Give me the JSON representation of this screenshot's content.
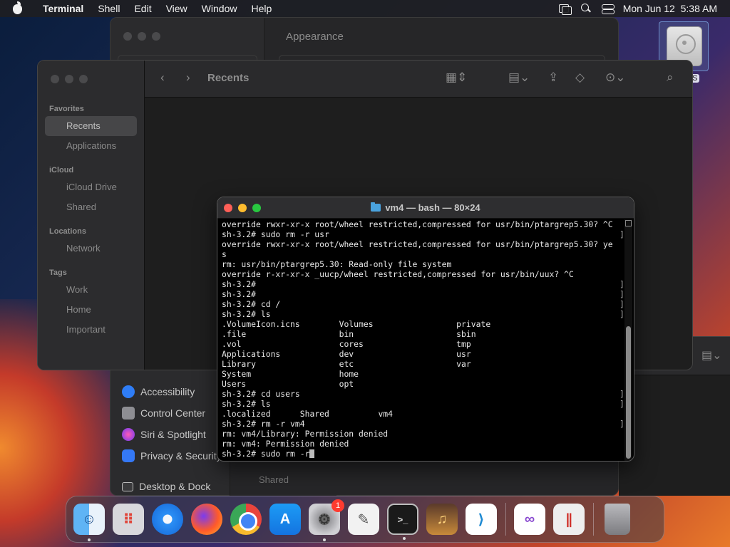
{
  "menubar": {
    "app": "Terminal",
    "items": [
      "Shell",
      "Edit",
      "View",
      "Window",
      "Help"
    ],
    "datetime": "Mon Jun 12  5:38 AM"
  },
  "desktop": {
    "disk_label": "S"
  },
  "settings_window": {
    "title": "Appearance",
    "sidebar": [
      {
        "label": "Accessibility",
        "color": "#2f7df6"
      },
      {
        "label": "Control Center",
        "color": "#8e8e93"
      },
      {
        "label": "Siri & Spotlight",
        "color": "#b34ad0"
      },
      {
        "label": "Privacy & Security",
        "color": "#3478f6"
      },
      {
        "label": "Desktop & Dock",
        "color": "#3a3a3c"
      }
    ]
  },
  "finder": {
    "title": "Recents",
    "favorites_heading": "Favorites",
    "favorites": [
      "Recents",
      "Applications"
    ],
    "icloud_heading": "iCloud",
    "icloud": [
      "iCloud Drive",
      "Shared"
    ],
    "locations_heading": "Locations",
    "locations": [
      "Network"
    ],
    "tags_heading": "Tags",
    "tags": [
      "Work",
      "Home",
      "Important"
    ]
  },
  "finder_fragment": {
    "shared": "Shared"
  },
  "terminal": {
    "title": "vm4 — bash — 80×24",
    "lines": [
      {
        "text": "override rwxr-xr-x root/wheel restricted,compressed for usr/bin/ptargrep5.30? ^C",
        "bracket": false
      },
      {
        "text": "sh-3.2# sudo rm -r usr",
        "bracket": true
      },
      {
        "text": "override rwxr-xr-x root/wheel restricted,compressed for usr/bin/ptargrep5.30? ye",
        "bracket": false
      },
      {
        "text": "s",
        "bracket": false
      },
      {
        "text": "rm: usr/bin/ptargrep5.30: Read-only file system",
        "bracket": false
      },
      {
        "text": "override r-xr-xr-x _uucp/wheel restricted,compressed for usr/bin/uux? ^C",
        "bracket": false
      },
      {
        "text": "sh-3.2#",
        "bracket": true
      },
      {
        "text": "sh-3.2#",
        "bracket": true
      },
      {
        "text": "sh-3.2# cd /",
        "bracket": true
      },
      {
        "text": "sh-3.2# ls",
        "bracket": true
      },
      {
        "text": ".VolumeIcon.icns        Volumes                 private",
        "bracket": false
      },
      {
        "text": ".file                   bin                     sbin",
        "bracket": false
      },
      {
        "text": ".vol                    cores                   tmp",
        "bracket": false
      },
      {
        "text": "Applications            dev                     usr",
        "bracket": false
      },
      {
        "text": "Library                 etc                     var",
        "bracket": false
      },
      {
        "text": "System                  home",
        "bracket": false
      },
      {
        "text": "Users                   opt",
        "bracket": false
      },
      {
        "text": "sh-3.2# cd users",
        "bracket": true
      },
      {
        "text": "sh-3.2# ls",
        "bracket": true
      },
      {
        "text": ".localized      Shared          vm4",
        "bracket": false
      },
      {
        "text": "sh-3.2# rm -r vm4",
        "bracket": true
      },
      {
        "text": "rm: vm4/Library: Permission denied",
        "bracket": false
      },
      {
        "text": "rm: vm4: Permission denied",
        "bracket": false
      }
    ],
    "prompt_line": "sh-3.2# sudo rm -r"
  },
  "dock": {
    "apps": [
      {
        "name": "Finder",
        "icon": "finder-icon",
        "running": true
      },
      {
        "name": "Launchpad",
        "icon": "launchpad-icon",
        "running": false
      },
      {
        "name": "Safari",
        "icon": "safari-icon",
        "running": false
      },
      {
        "name": "Firefox",
        "icon": "firefox-icon",
        "running": false
      },
      {
        "name": "Chrome",
        "icon": "chrome-icon",
        "running": false
      },
      {
        "name": "App Store",
        "icon": "app-store-icon",
        "running": false
      },
      {
        "name": "System Settings",
        "icon": "system-settings-icon",
        "running": true,
        "badge": "1"
      },
      {
        "name": "TextEdit",
        "icon": "textedit-icon",
        "running": false
      },
      {
        "name": "Terminal",
        "icon": "terminal-icon",
        "running": true
      },
      {
        "name": "GarageBand",
        "icon": "garageband-icon",
        "running": false
      },
      {
        "name": "Visual Studio Code",
        "icon": "vscode-icon",
        "running": false
      },
      {
        "name": "Visual Studio",
        "icon": "visual-studio-icon",
        "running": false
      },
      {
        "name": "Parallels",
        "icon": "parallels-icon",
        "running": false
      },
      {
        "name": "Trash",
        "icon": "trash-icon",
        "running": false
      }
    ]
  }
}
